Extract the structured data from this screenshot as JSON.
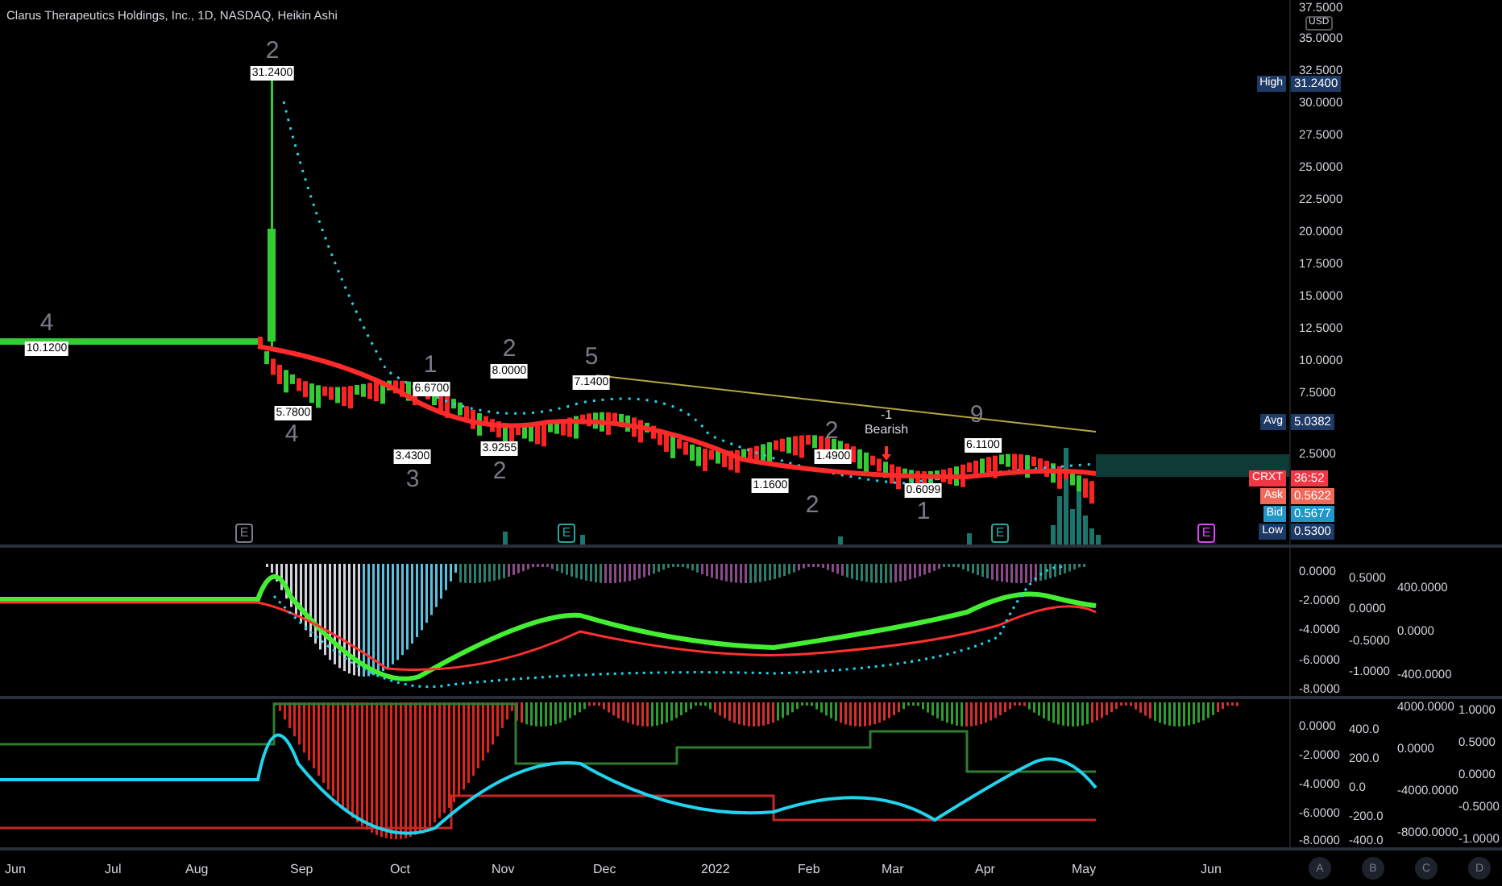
{
  "header": {
    "title": "Clarus Therapeutics Holdings, Inc., 1D, NASDAQ, Heikin Ashi"
  },
  "price_pane": {
    "currency": "USD",
    "axis_labels": [
      "37.5000",
      "35.0000",
      "32.5000",
      "30.0000",
      "27.5000",
      "25.0000",
      "22.5000",
      "20.0000",
      "17.5000",
      "15.0000",
      "12.5000",
      "10.0000",
      "7.5000",
      "2.5000"
    ],
    "badges": [
      {
        "kind": "high",
        "label": "High",
        "value": "31.2400"
      },
      {
        "kind": "avg",
        "label": "Avg",
        "value": "5.0382"
      },
      {
        "kind": "symbol",
        "label": "CRXT",
        "value": "36:52"
      },
      {
        "kind": "ask",
        "label": "Ask",
        "value": "0.5622"
      },
      {
        "kind": "bid",
        "label": "Bid",
        "value": "0.5677"
      },
      {
        "kind": "low",
        "label": "Low",
        "value": "0.5300"
      }
    ],
    "price_labels": [
      "31.2400",
      "10.1200",
      "5.7800",
      "6.6700",
      "3.4300",
      "8.0000",
      "3.9255",
      "7.1400",
      "1.1600",
      "1.4900",
      "0.6099",
      "6.1100"
    ],
    "wave_counts": [
      "2",
      "4",
      "4",
      "1",
      "3",
      "2",
      "2",
      "5",
      "2",
      "2",
      "1",
      "9"
    ],
    "signal": {
      "value": "-1",
      "label": "Bearish"
    },
    "earnings_markers": [
      {
        "label": "E",
        "color": "#787b86"
      },
      {
        "label": "E",
        "color": "#26a69a"
      },
      {
        "label": "E",
        "color": "#26a69a"
      },
      {
        "label": "E",
        "color": "#e040fb"
      }
    ]
  },
  "pane_2": {
    "axes": [
      [
        "0.0000",
        "-2.0000",
        "-4.0000",
        "-6.0000",
        "-8.0000"
      ],
      [
        "0.5000",
        "0.0000",
        "-0.5000",
        "-1.0000"
      ],
      [
        "400.0000",
        "0.0000",
        "-400.0000"
      ]
    ]
  },
  "pane_3": {
    "axes": [
      [
        "0.0000",
        "-2.0000",
        "-4.0000",
        "-6.0000",
        "-8.0000"
      ],
      [
        "400.0",
        "200.0",
        "0.0",
        "-200.0",
        "-400.0"
      ],
      [
        "4000.0000",
        "0.0000",
        "-4000.0000",
        "-8000.0000"
      ],
      [
        "1.0000",
        "0.5000",
        "0.0000",
        "-0.5000",
        "-1.0000"
      ]
    ]
  },
  "time_axis": [
    "Jun",
    "Jul",
    "Aug",
    "Sep",
    "Oct",
    "Nov",
    "Dec",
    "2022",
    "Feb",
    "Mar",
    "Apr",
    "May",
    "Jun"
  ],
  "scale_buttons": [
    "A",
    "B",
    "C",
    "D"
  ]
}
